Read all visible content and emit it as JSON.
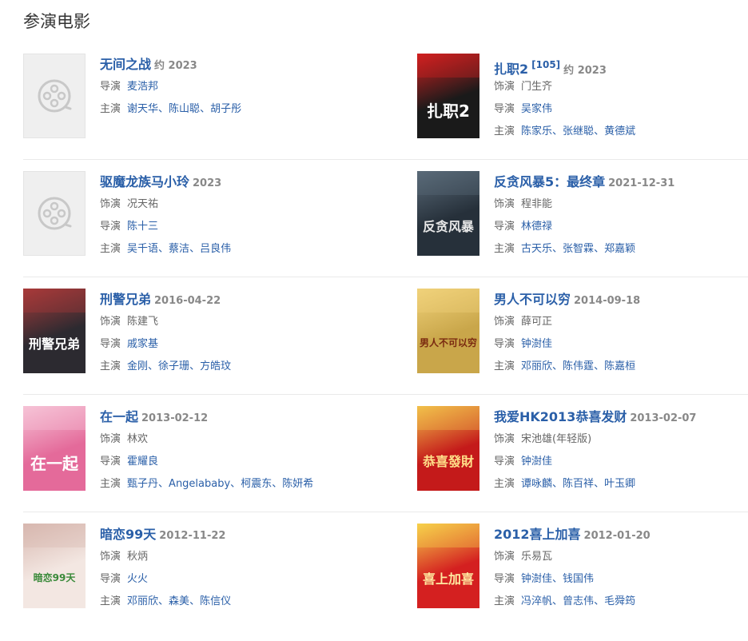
{
  "section_title": "参演电影",
  "labels": {
    "role": "饰演",
    "director": "导演",
    "cast": "主演"
  },
  "films": [
    {
      "title": "无间之战",
      "date": "约 2023",
      "ref": "",
      "role": "",
      "directors": [
        "麦浩邦"
      ],
      "cast": [
        "谢天华",
        "陈山聪",
        "胡子彤"
      ],
      "poster": {
        "placeholder": true,
        "icon": "film-reel-icon"
      }
    },
    {
      "title": "扎职2",
      "date": "约 2023",
      "ref": "[105]",
      "role": "门生齐",
      "directors": [
        "吴家伟"
      ],
      "cast": [
        "陈家乐",
        "张继聪",
        "黄德斌"
      ],
      "poster": {
        "placeholder": false,
        "text": "扎职2",
        "bg": "#1a1a1a",
        "accent": "#d02020",
        "fg": "#ffffff"
      }
    },
    {
      "title": "驱魔龙族马小玲",
      "date": "2023",
      "ref": "",
      "role": "况天祐",
      "directors": [
        "陈十三"
      ],
      "cast": [
        "吴千语",
        "蔡洁",
        "吕良伟"
      ],
      "poster": {
        "placeholder": true,
        "icon": "film-reel-icon"
      }
    },
    {
      "title": "反贪风暴5：最终章",
      "date": "2021-12-31",
      "ref": "",
      "role": "程非能",
      "directors": [
        "林德禄"
      ],
      "cast": [
        "古天乐",
        "张智霖",
        "郑嘉颖"
      ],
      "poster": {
        "placeholder": false,
        "text": "反贪风暴",
        "bg": "#26303a",
        "accent": "#5a6a78",
        "fg": "#e8e8e8"
      }
    },
    {
      "title": "刑警兄弟",
      "date": "2016-04-22",
      "ref": "",
      "role": "陈建飞",
      "directors": [
        "戚家基"
      ],
      "cast": [
        "金刚",
        "徐子珊",
        "方皓玟"
      ],
      "poster": {
        "placeholder": false,
        "text": "刑警兄弟",
        "bg": "#2c2a30",
        "accent": "#a83a3a",
        "fg": "#ffffff"
      }
    },
    {
      "title": "男人不可以穷",
      "date": "2014-09-18",
      "ref": "",
      "role": "薛可正",
      "directors": [
        "钟澍佳"
      ],
      "cast": [
        "邓丽欣",
        "陈伟霆",
        "陈嘉桓"
      ],
      "poster": {
        "placeholder": false,
        "text": "男人不可以穷",
        "bg": "#c9a64a",
        "accent": "#f0d27a",
        "fg": "#7a2a10"
      }
    },
    {
      "title": "在一起",
      "date": "2013-02-12",
      "ref": "",
      "role": "林欢",
      "directors": [
        "霍耀良"
      ],
      "cast": [
        "甄子丹",
        "Angelababy",
        "柯震东",
        "陈妍希"
      ],
      "poster": {
        "placeholder": false,
        "text": "在一起",
        "bg": "#e46a9a",
        "accent": "#f6c3d6",
        "fg": "#ffffff"
      }
    },
    {
      "title": "我爱HK2013恭喜发财",
      "date": "2013-02-07",
      "ref": "",
      "role": "宋池雄(年轻版)",
      "directors": [
        "钟澍佳"
      ],
      "cast": [
        "谭咏麟",
        "陈百祥",
        "叶玉卿"
      ],
      "poster": {
        "placeholder": false,
        "text": "恭喜發財",
        "bg": "#c41a1a",
        "accent": "#f2c14a",
        "fg": "#ffe08a"
      }
    },
    {
      "title": "暗恋99天",
      "date": "2012-11-22",
      "ref": "",
      "role": "秋炳",
      "directors": [
        "火火"
      ],
      "cast": [
        "邓丽欣",
        "森美",
        "陈信仪"
      ],
      "poster": {
        "placeholder": false,
        "text": "暗恋99天",
        "bg": "#f3e7e2",
        "accent": "#d8b8b0",
        "fg": "#3a8a3a"
      }
    },
    {
      "title": "2012喜上加喜",
      "date": "2012-01-20",
      "ref": "",
      "role": "乐易瓦",
      "directors": [
        "钟澍佳",
        "钱国伟"
      ],
      "cast": [
        "冯淬帆",
        "曾志伟",
        "毛舜筠"
      ],
      "poster": {
        "placeholder": false,
        "text": "喜上加喜",
        "bg": "#d42020",
        "accent": "#f7d14a",
        "fg": "#ffe9a0"
      }
    }
  ]
}
